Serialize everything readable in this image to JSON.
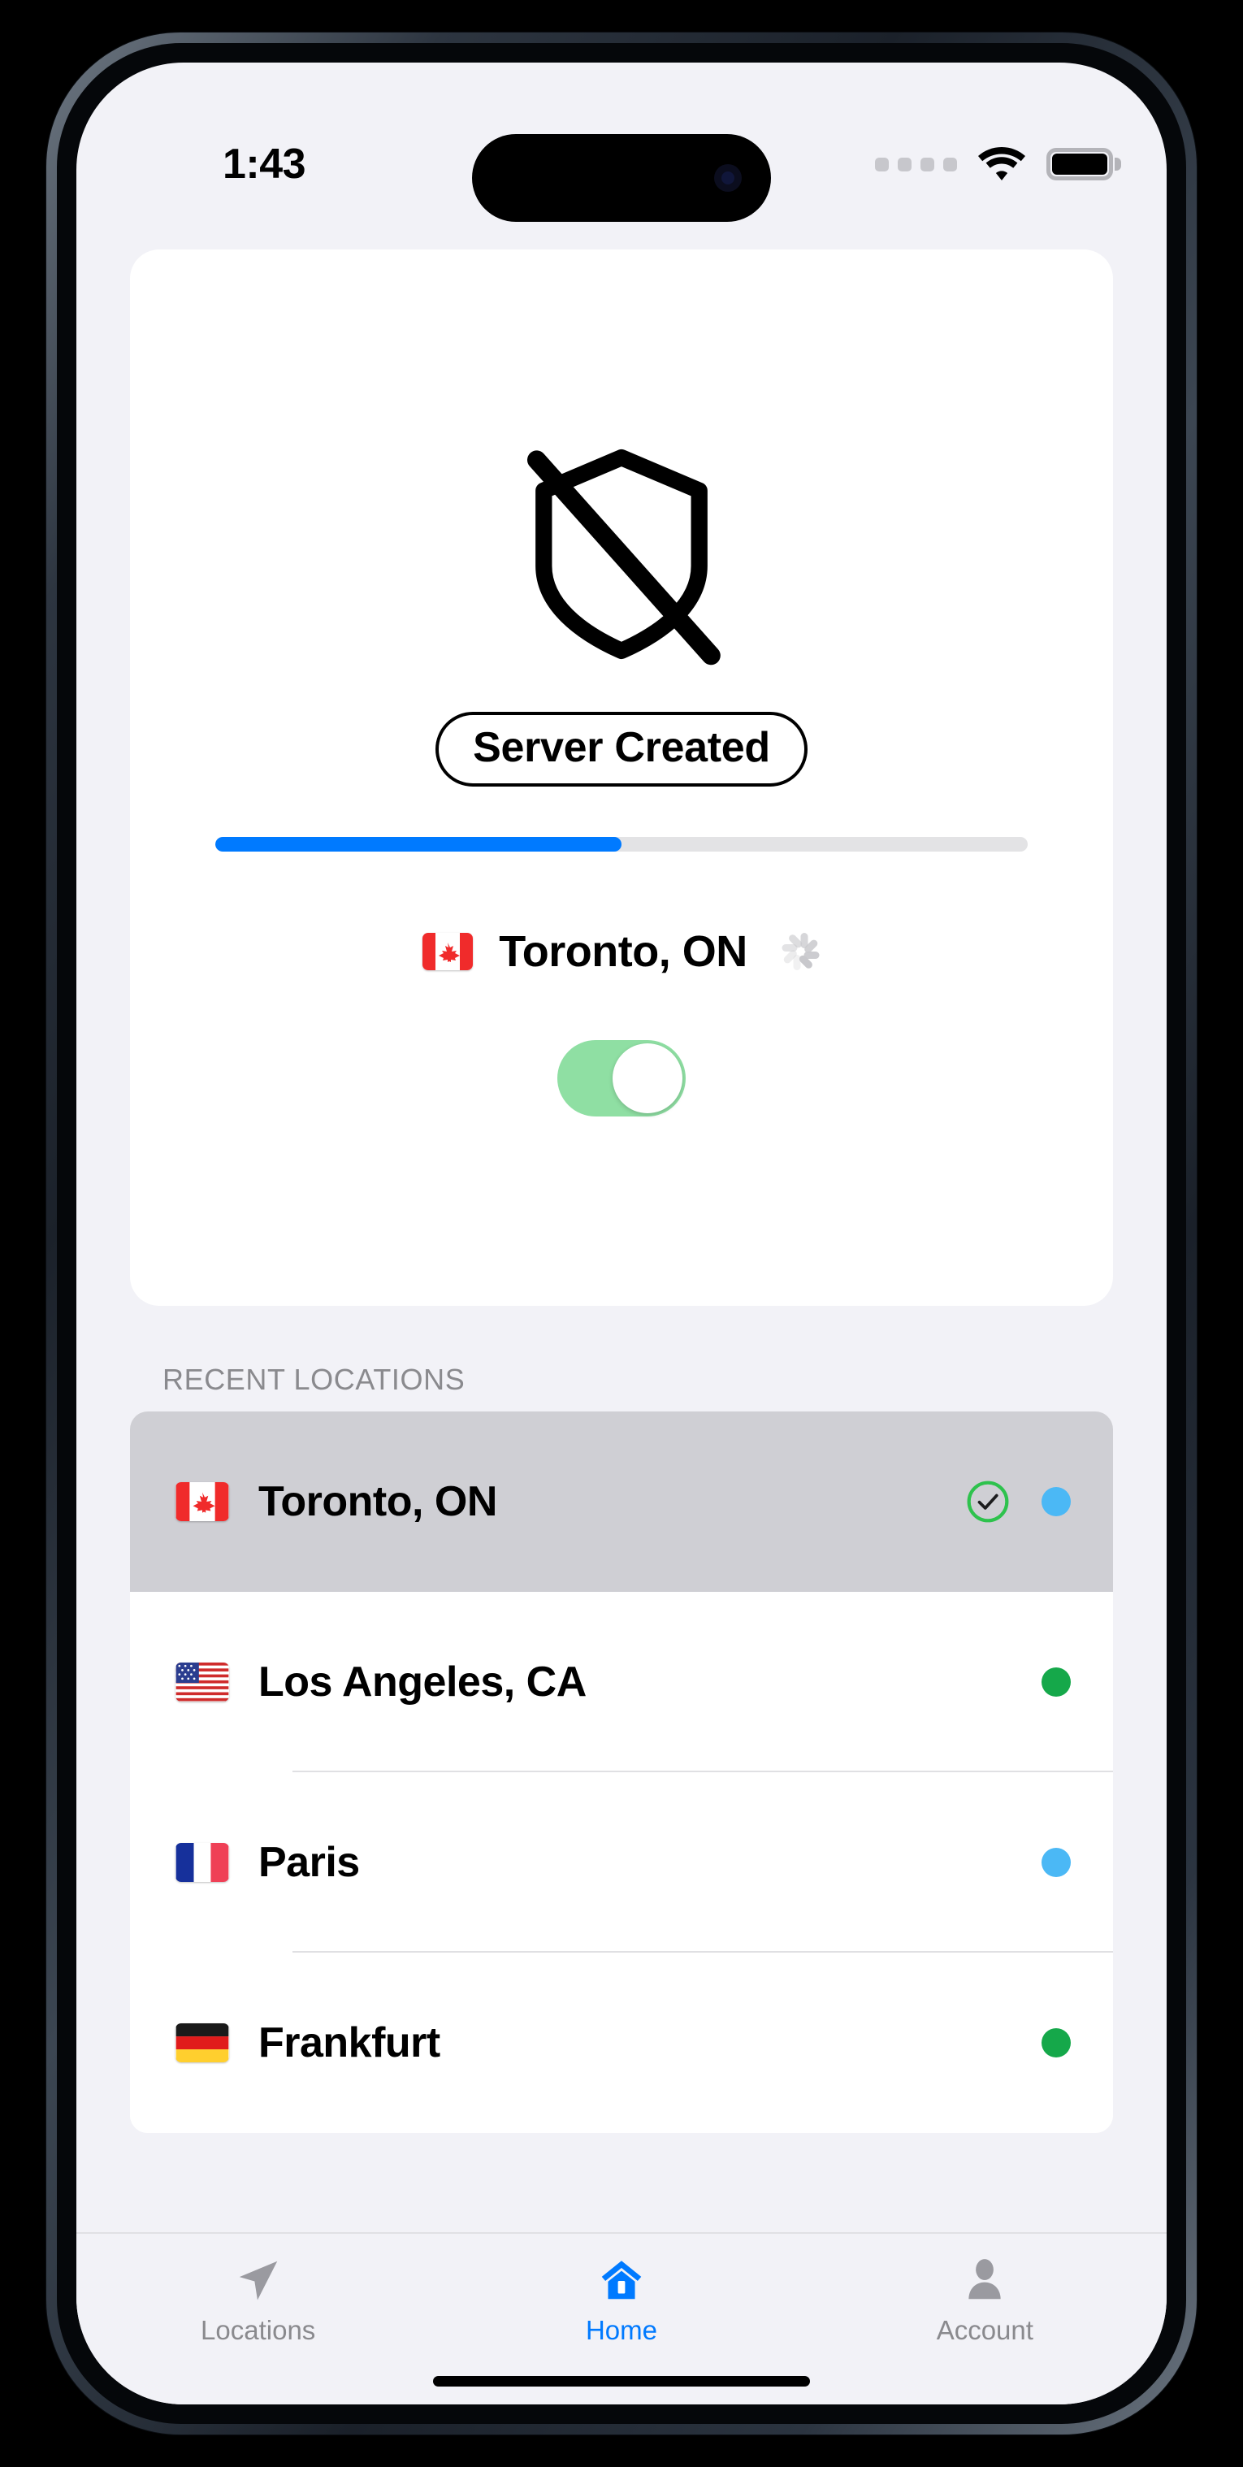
{
  "status_bar": {
    "time": "1:43",
    "signal_icon": "cellular-dots-icon",
    "wifi_icon": "wifi-icon",
    "battery_icon": "battery-full-icon"
  },
  "status_card": {
    "shield_icon": "shield-slash-icon",
    "connection_status": "Server Created",
    "progress_percent": 50,
    "progress_fill_color": "#007aff",
    "progress_track_color": "#e3e3e5",
    "current_location": {
      "flag": "canada-flag-icon",
      "name": "Toronto, ON",
      "spinner": "loading-spinner-icon"
    },
    "vpn_toggle": {
      "state": "on",
      "track_color": "#8fdfa3"
    }
  },
  "recent_locations": {
    "header": "RECENT LOCATIONS",
    "items": [
      {
        "flag": "canada-flag-icon",
        "name": "Toronto, ON",
        "selected": true,
        "checked": true,
        "dot_color": "#4bb8f5"
      },
      {
        "flag": "usa-flag-icon",
        "name": "Los Angeles, CA",
        "selected": false,
        "checked": false,
        "dot_color": "#15a84a"
      },
      {
        "flag": "france-flag-icon",
        "name": "Paris",
        "selected": false,
        "checked": false,
        "dot_color": "#4bb8f5"
      },
      {
        "flag": "germany-flag-icon",
        "name": "Frankfurt",
        "selected": false,
        "checked": false,
        "dot_color": "#15a84a"
      }
    ]
  },
  "tab_bar": {
    "active_color": "#007aff",
    "inactive_color": "#8a8a8e",
    "items": [
      {
        "icon": "location-arrow-icon",
        "label": "Locations",
        "active": false
      },
      {
        "icon": "home-icon",
        "label": "Home",
        "active": true
      },
      {
        "icon": "account-person-icon",
        "label": "Account",
        "active": false
      }
    ]
  }
}
